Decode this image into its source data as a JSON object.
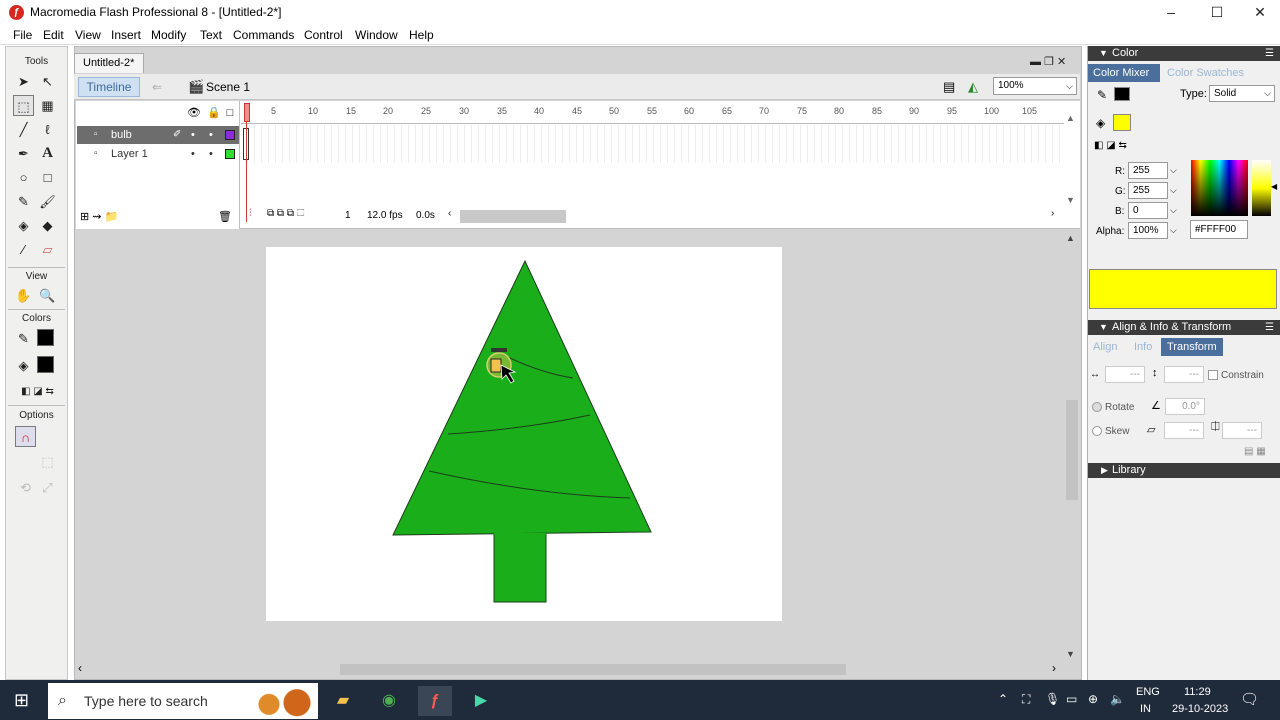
{
  "window": {
    "title": "Macromedia Flash Professional 8 - [Untitled-2*]",
    "minimize": "–",
    "maximize": "☐",
    "close": "✕"
  },
  "menu": [
    "File",
    "Edit",
    "View",
    "Insert",
    "Modify",
    "Text",
    "Commands",
    "Control",
    "Window",
    "Help"
  ],
  "tools": {
    "header": "Tools",
    "view_header": "View",
    "colors_header": "Colors",
    "options_header": "Options"
  },
  "document": {
    "tab": "Untitled-2*",
    "timeline_button": "Timeline",
    "scene": "Scene 1",
    "zoom": "100%"
  },
  "timeline": {
    "layers": [
      {
        "name": "bulb",
        "color": "#8a2be2",
        "selected": true
      },
      {
        "name": "Layer 1",
        "color": "#33dd33",
        "selected": false
      }
    ],
    "ruler": [
      "5",
      "10",
      "15",
      "20",
      "25",
      "30",
      "35",
      "40",
      "45",
      "50",
      "55",
      "60",
      "65",
      "70",
      "75",
      "80",
      "85",
      "90",
      "95",
      "100",
      "105"
    ],
    "current_frame": "1",
    "fps": "12.0 fps",
    "time": "0.0s"
  },
  "color_panel": {
    "header": "Color",
    "tab_mixer": "Color Mixer",
    "tab_swatches": "Color Swatches",
    "type_label": "Type:",
    "type_value": "Solid",
    "r_label": "R:",
    "r": "255",
    "g_label": "G:",
    "g": "255",
    "b_label": "B:",
    "b": "0",
    "alpha_label": "Alpha:",
    "alpha": "100%",
    "hex": "#FFFF00",
    "preview_color": "#FFFF00"
  },
  "align_panel": {
    "header": "Align & Info & Transform",
    "tabs": [
      "Align",
      "Info",
      "Transform"
    ],
    "w": "---",
    "h": "---",
    "constrain": "Constrain",
    "rotate_label": "Rotate",
    "rotate_value": "0.0°",
    "skew_label": "Skew",
    "skew_h": "---",
    "skew_v": "---"
  },
  "library_panel": {
    "header": "Library"
  },
  "taskbar": {
    "search": "Type here to search",
    "lang_top": "ENG",
    "lang_bottom": "IN",
    "time": "11:29",
    "date": "29-10-2023"
  },
  "colors": {
    "tree": "#1aae1a",
    "stage": "#ffffff",
    "workarea": "#d4d4d4"
  }
}
